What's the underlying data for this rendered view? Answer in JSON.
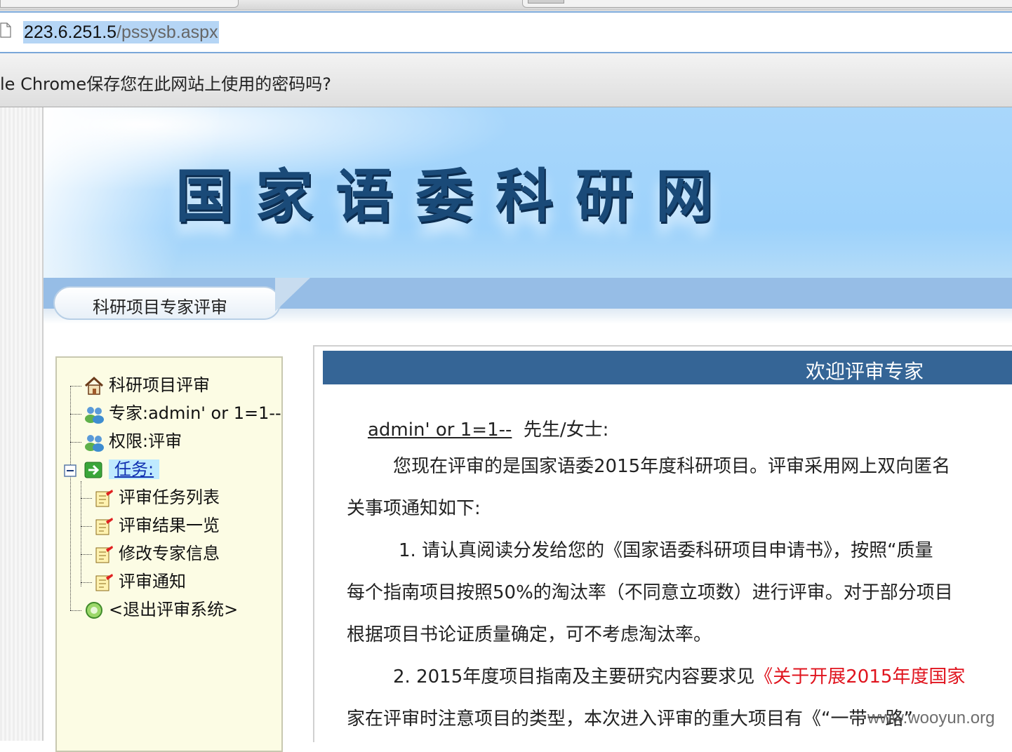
{
  "browser": {
    "url_host": "223.6.251.5",
    "url_path": "/pssysb.aspx",
    "infobar_text": "le Chrome保存您在此网站上使用的密码吗?"
  },
  "banner": {
    "title": "国家语委科研网"
  },
  "nav": {
    "tab_label": "科研项目专家评审"
  },
  "tree": {
    "root_label": "科研项目评审",
    "expert_label": "专家:admin' or 1=1--",
    "permission_label": "权限:评审",
    "task_label": "任务:",
    "task_children": [
      "评审任务列表",
      "评审结果一览",
      "修改专家信息",
      "评审通知"
    ],
    "exit_label": "<退出评审系统>"
  },
  "content": {
    "welcome_title": "欢迎评审专家",
    "user_name": "admin' or 1=1--",
    "salutation": "先生/女士:",
    "para1_line1": "您现在评审的是国家语委2015年度科研项目。评审采用网上双向匿名",
    "para1_line2": "关事项通知如下:",
    "item1_line1": "1. 请认真阅读分发给您的《国家语委科研项目申请书》，按照“质量",
    "item1_line2": "每个指南项目按照50%的淘汰率（不同意立项数）进行评审。对于部分项目",
    "item1_line3": "根据项目书论证质量确定，可不考虑淘汰率。",
    "item2_prefix": "2. 2015年度项目指南及主要研究内容要求见",
    "item2_link": "《关于开展2015年度国家",
    "item2_line2": "家在评审时注意项目的类型，本次进入评审的重大项目有《“一带一路”"
  },
  "watermark": "www.wooyun.org",
  "colors": {
    "welcome_bar": "#356596",
    "banner_blue": "#9dd2fb",
    "tree_bg": "#fcfce4",
    "link_red": "#e0141e"
  }
}
